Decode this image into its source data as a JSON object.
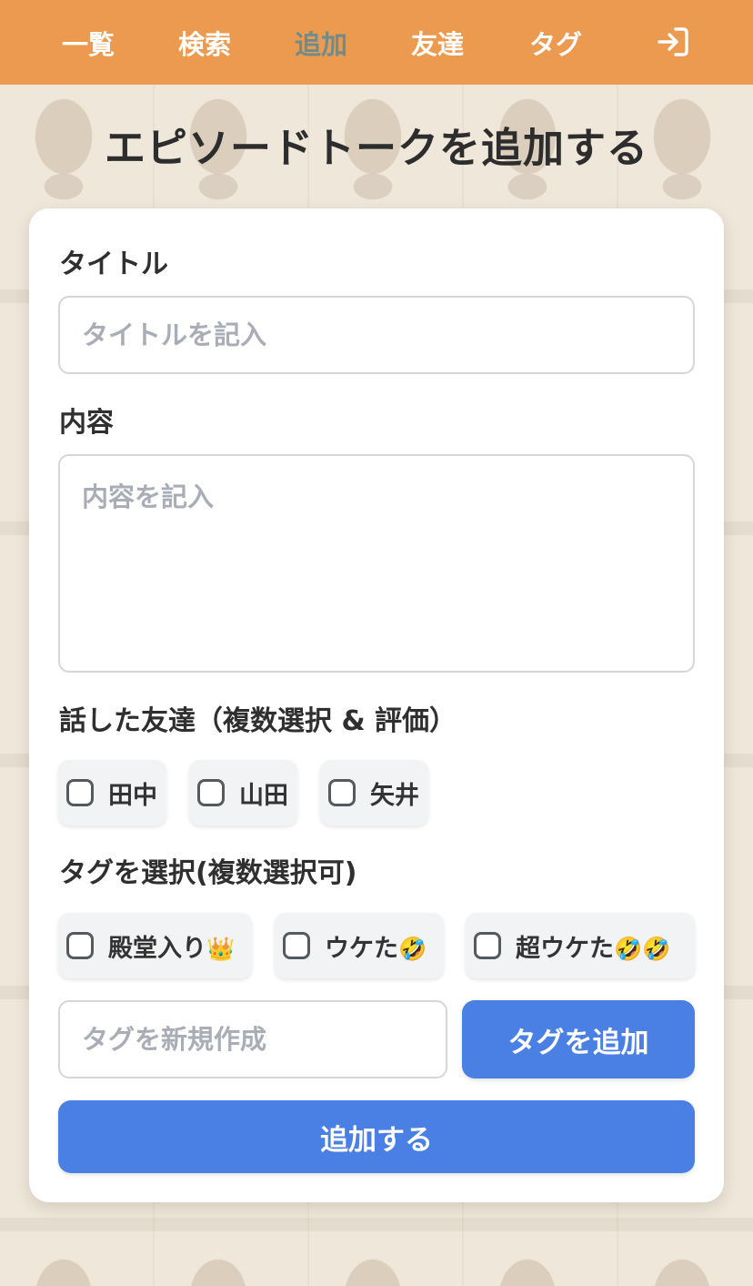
{
  "nav": {
    "items": [
      {
        "label": "一覧",
        "active": false
      },
      {
        "label": "検索",
        "active": false
      },
      {
        "label": "追加",
        "active": true
      },
      {
        "label": "友達",
        "active": false
      },
      {
        "label": "タグ",
        "active": false
      }
    ],
    "login_icon": "login-icon"
  },
  "page": {
    "title": "エピソードトークを追加する"
  },
  "form": {
    "title_label": "タイトル",
    "title_placeholder": "タイトルを記入",
    "content_label": "内容",
    "content_placeholder": "内容を記入",
    "friends_label": "話した友達（複数選択 & 評価）",
    "friends": [
      {
        "name": "田中",
        "checked": false
      },
      {
        "name": "山田",
        "checked": false
      },
      {
        "name": "矢井",
        "checked": false
      }
    ],
    "tags_label": "タグを選択(複数選択可)",
    "tags": [
      {
        "name": "殿堂入り",
        "emoji": "👑",
        "checked": false
      },
      {
        "name": "ウケた",
        "emoji": "🤣",
        "checked": false
      },
      {
        "name": "超ウケた",
        "emoji": "🤣🤣",
        "checked": false
      }
    ],
    "new_tag_placeholder": "タグを新規作成",
    "add_tag_button": "タグを追加",
    "submit_button": "追加する"
  },
  "colors": {
    "header": "#ec9a50",
    "active_nav": "#6f8c8c",
    "primary_button": "#4a7fe4"
  }
}
